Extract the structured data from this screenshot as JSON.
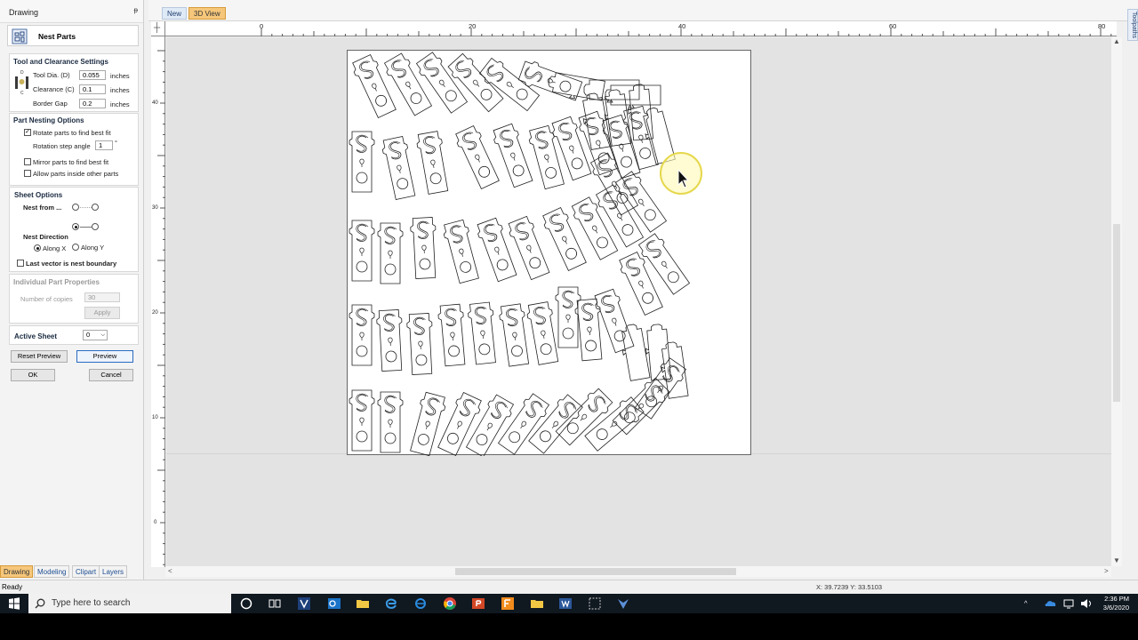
{
  "panel": {
    "title": "Drawing",
    "pin": "ᵽ",
    "tool_name": "Nest Parts",
    "tool_clearance": {
      "heading": "Tool and Clearance Settings",
      "tool_dia_label": "Tool Dia. (D)",
      "tool_dia_value": "0.055",
      "clearance_label": "Clearance (C)",
      "clearance_value": "0.1",
      "border_gap_label": "Border Gap",
      "border_gap_value": "0.2",
      "unit": "inches",
      "diagram_d": "D",
      "diagram_c": "C"
    },
    "nesting": {
      "heading": "Part Nesting Options",
      "rotate_label": "Rotate parts to find best fit",
      "rotate_checked": true,
      "rotation_step_label": "Rotation step angle",
      "rotation_step_value": "1",
      "degree": "°",
      "mirror_label": "Mirror parts to find best fit",
      "allow_inside_label": "Allow parts inside other parts"
    },
    "sheet": {
      "heading": "Sheet Options",
      "nest_from_label": "Nest from ...",
      "nest_direction_label": "Nest Direction",
      "along_x": "Along X",
      "along_y": "Along Y",
      "last_vector_label": "Last vector is nest boundary"
    },
    "individual": {
      "heading": "Individual Part Properties",
      "copies_label": "Number of copies",
      "copies_value": "30",
      "apply_label": "Apply"
    },
    "active_sheet": {
      "label": "Active Sheet",
      "value": "0"
    },
    "reset_preview": "Reset Preview",
    "preview": "Preview",
    "ok": "OK",
    "cancel": "Cancel"
  },
  "bottom_tabs": [
    "Drawing",
    "Modeling",
    "Clipart",
    "Layers"
  ],
  "top_tabs": {
    "new": "New",
    "view3d": "3D View"
  },
  "toolpaths": "Toolpaths",
  "ruler": {
    "h_labels": [
      "0",
      "20",
      "40",
      "60",
      "80"
    ],
    "v_labels": [
      "40",
      "30",
      "20",
      "10",
      "0"
    ]
  },
  "status": {
    "left": "Ready",
    "coords": "X: 39.7239 Y: 33.5103"
  },
  "taskbar": {
    "search_placeholder": "Type here to search",
    "time": "2:36 PM",
    "date": "3/6/2020"
  },
  "colors": {
    "accent_orange": "#f6c77b",
    "accent_blue": "#1d4d91",
    "taskbar": "#101820"
  }
}
